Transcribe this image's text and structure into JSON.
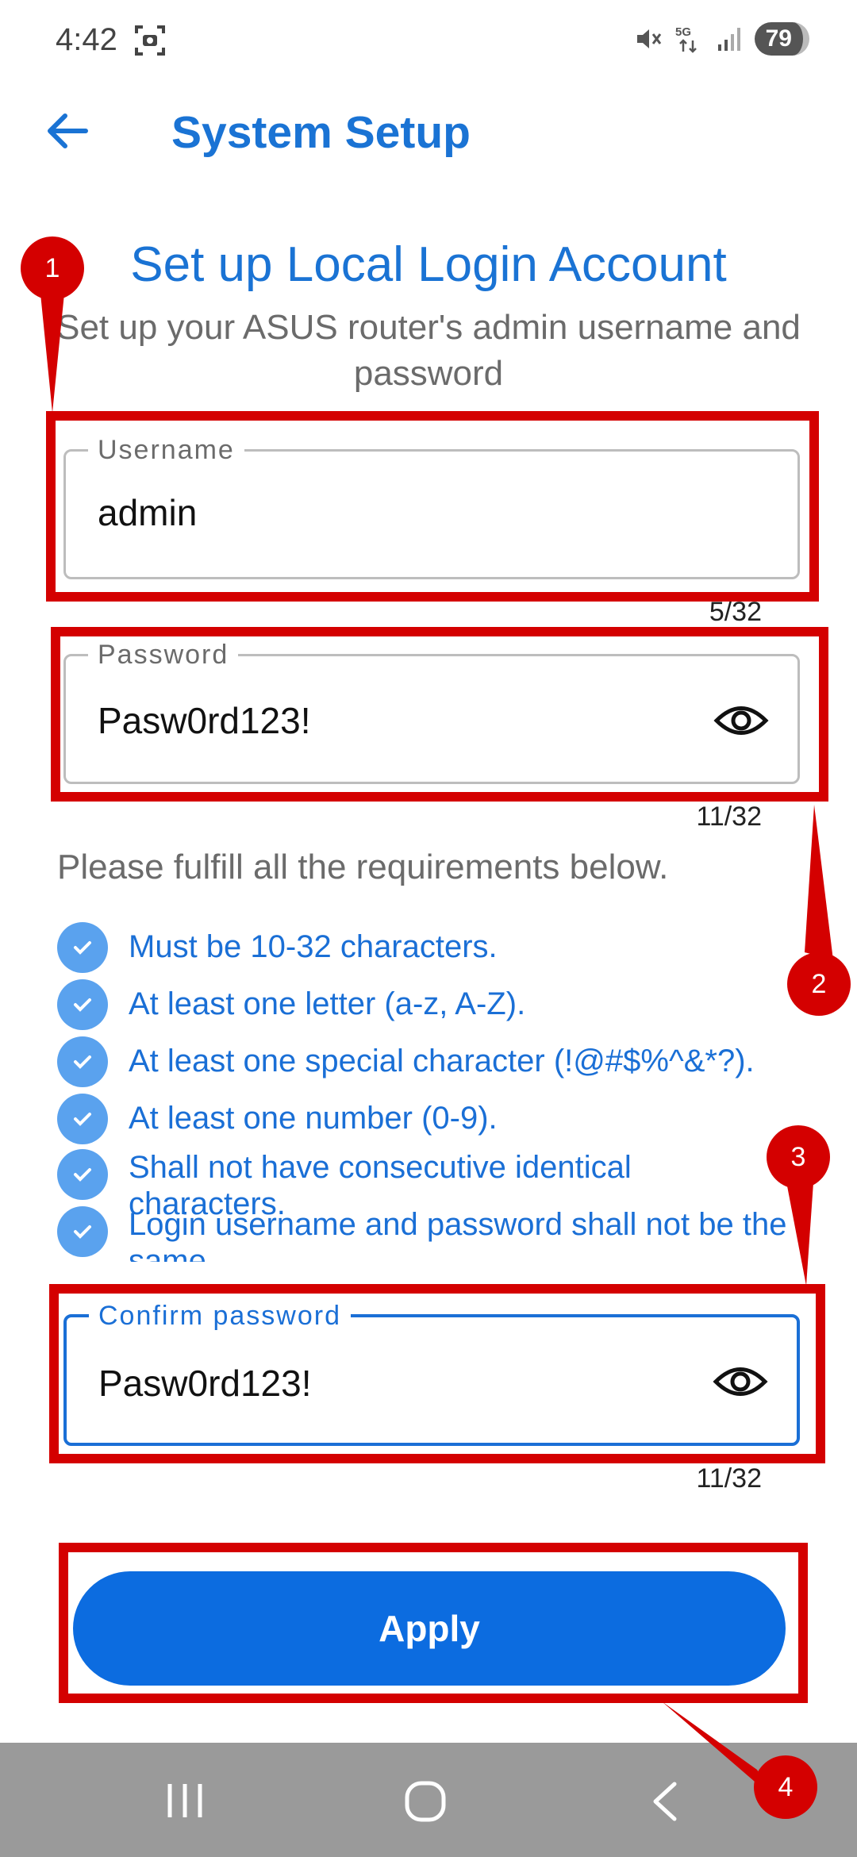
{
  "status_bar": {
    "time": "4:42",
    "battery": "79"
  },
  "header": {
    "title": "System Setup"
  },
  "heading": "Set up Local Login Account",
  "subheading": "Set up your ASUS router's admin username and password",
  "username": {
    "label": "Username",
    "value": "admin",
    "counter": "5/32"
  },
  "password": {
    "label": "Password",
    "value": "Pasw0rd123!",
    "counter": "11/32"
  },
  "requirements": {
    "intro": "Please fulfill all the requirements below.",
    "items": [
      {
        "text": "Must be 10-32 characters."
      },
      {
        "text": "At least one letter (a-z, A-Z)."
      },
      {
        "text": "At least one special character (!@#$%^&*?)."
      },
      {
        "text": "At least one number (0-9)."
      },
      {
        "text": "Shall not have consecutive identical characters."
      },
      {
        "text": "Login username and password shall not be the same."
      }
    ]
  },
  "confirm_password": {
    "label": "Confirm password",
    "value": "Pasw0rd123!",
    "counter": "11/32"
  },
  "apply_label": "Apply",
  "annotations": {
    "badge1": "1",
    "badge2": "2",
    "badge3": "3",
    "badge4": "4"
  },
  "colors": {
    "accent": "#1a73d4",
    "button": "#0c6ce0",
    "check": "#5aa2ee",
    "annotation": "#d40000"
  }
}
